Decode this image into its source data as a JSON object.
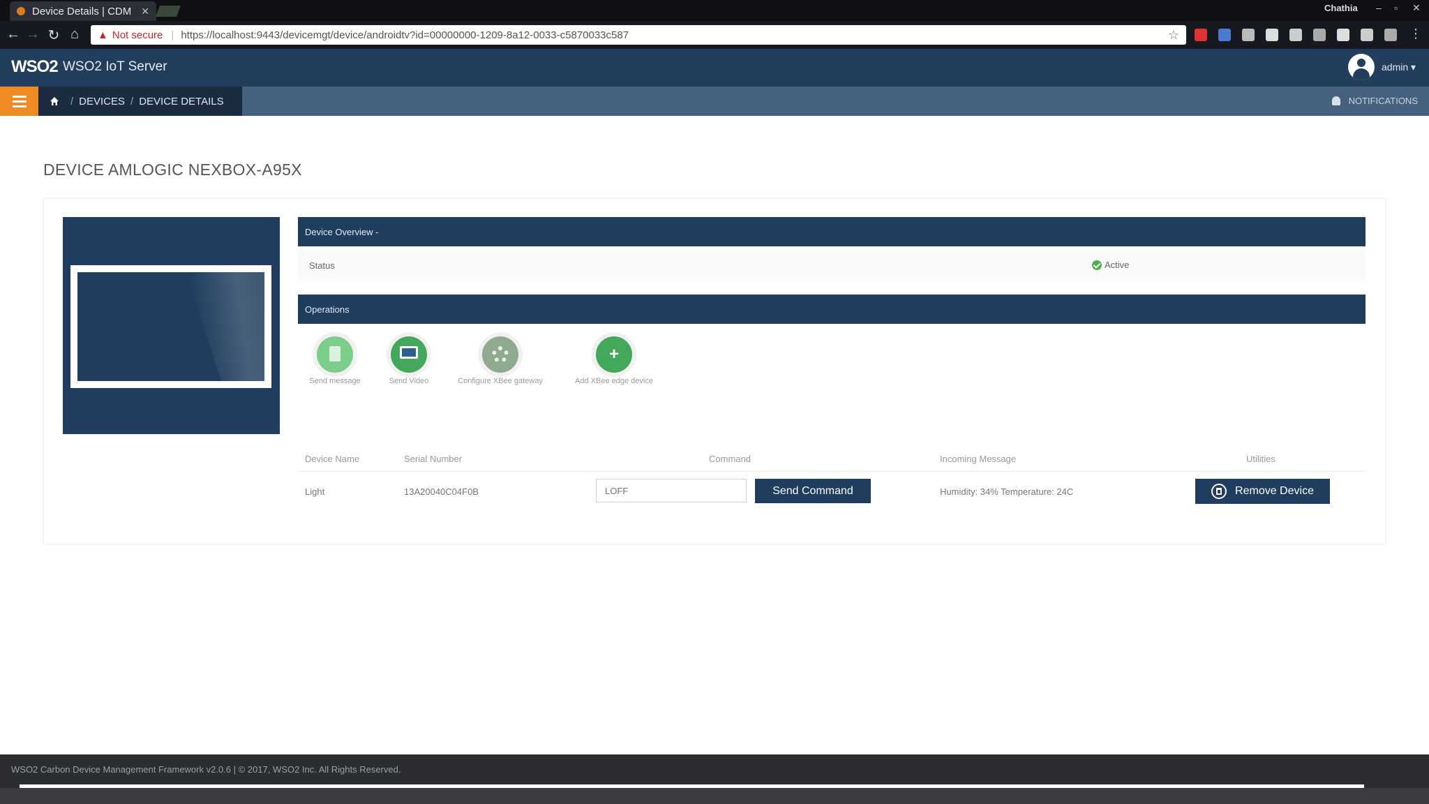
{
  "browser": {
    "tab_title": "Device Details | CDM",
    "window_user": "Chathia",
    "security_label": "Not secure",
    "url": "https://localhost:9443/devicemgt/device/androidtv?id=00000000-1209-8a12-0033-c5870033c587"
  },
  "header": {
    "logo_text": "WSO2",
    "app_name": "WSO2 IoT Server",
    "user_menu": "admin ▾"
  },
  "breadcrumb": {
    "items": [
      "DEVICES",
      "DEVICE DETAILS"
    ],
    "notifications": "NOTIFICATIONS"
  },
  "page": {
    "title": "DEVICE AMLOGIC NEXBOX-A95X"
  },
  "overview": {
    "header": "Device Overview -",
    "status_label": "Status",
    "status_value": "Active",
    "status_color": "#4caf50"
  },
  "operations": {
    "header": "Operations",
    "items": [
      {
        "label": "Send message",
        "icon": "message-icon"
      },
      {
        "label": "Send Video",
        "icon": "monitor-icon"
      },
      {
        "label": "Configure XBee gateway",
        "icon": "gear-icon"
      },
      {
        "label": "Add XBee edge device",
        "icon": "plus-icon"
      }
    ]
  },
  "table": {
    "headers": [
      "Device Name",
      "Serial Number",
      "Command",
      "Incoming Message",
      "Utilities"
    ],
    "rows": [
      {
        "device_name": "Light",
        "serial_number": "13A20040C04F0B",
        "command_placeholder": "LOFF",
        "send_label": "Send Command",
        "incoming_message": "Humidity: 34% Temperature: 24C",
        "remove_label": "Remove Device"
      }
    ]
  },
  "footer": {
    "text": "WSO2 Carbon Device Management Framework v2.0.6 | © 2017, WSO2 Inc. All Rights Reserved."
  },
  "colors": {
    "header_bg": "#233d5c",
    "breadcrumb_bg": "#46607f",
    "accent_orange": "#f08a24",
    "panel_navy": "#1f3d5e"
  }
}
